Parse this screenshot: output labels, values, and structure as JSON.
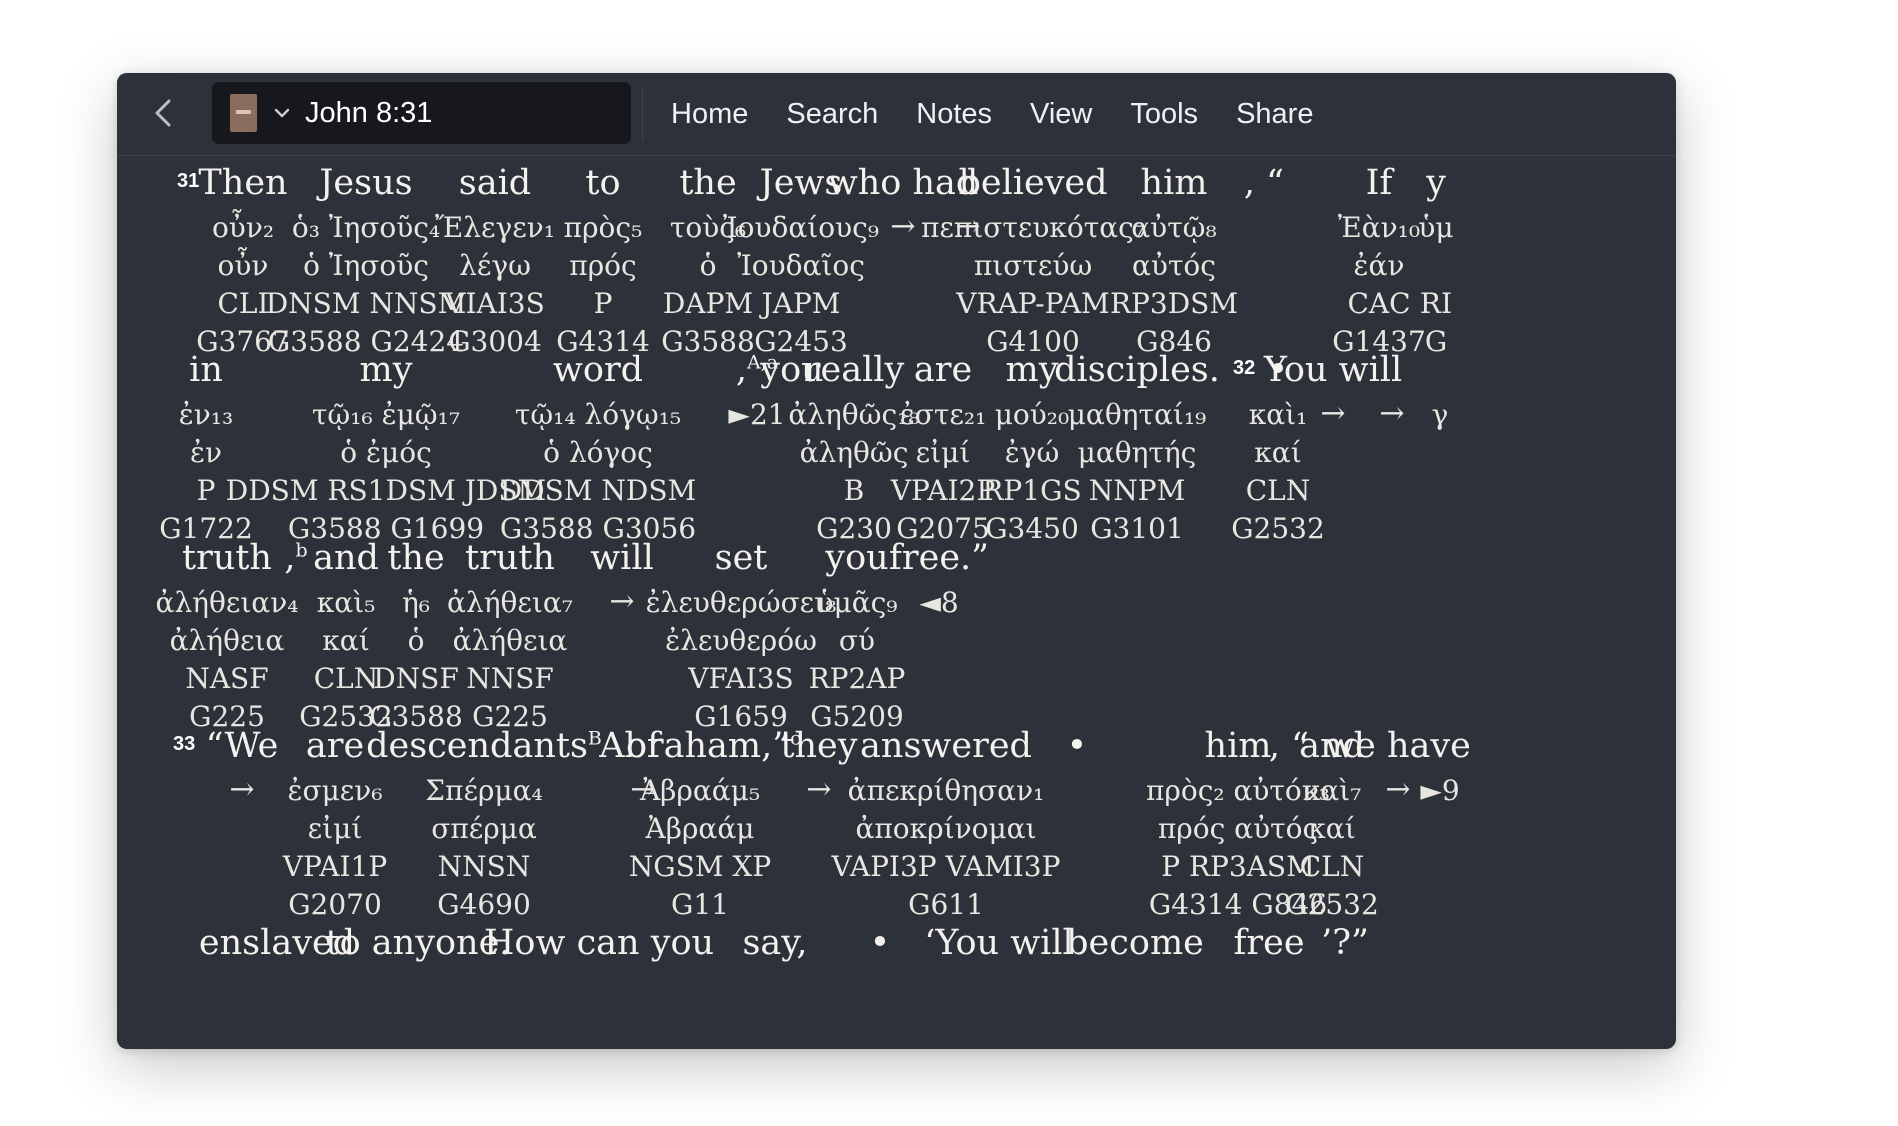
{
  "toolbar": {
    "reference": "John 8:31",
    "menu": [
      "Home",
      "Search",
      "Notes",
      "View",
      "Tools",
      "Share"
    ]
  },
  "icons": {
    "back": "chevron-left-icon",
    "book": "book-cover-icon",
    "dropdown": "chevron-down-icon"
  },
  "interlinear": [
    {
      "verse": "31",
      "words": [
        {
          "en": "Then",
          "gk": "οὖν₂",
          "lem": "οὖν",
          "morph": "CLI",
          "strong": "G3767"
        },
        {
          "en": "Jesus",
          "gk": "ὁ₃ Ἰησοῦς₄",
          "lem": "ὁ Ἰησοῦς",
          "morph": "DNSM NNSM",
          "strong": "G3588 G2424"
        },
        {
          "en": "said",
          "gk": "Ἔλεγεν₁",
          "lem": "λέγω",
          "morph": "VIAI3S",
          "strong": "G3004"
        },
        {
          "en": "to",
          "gk": "πρὸς₅",
          "lem": "πρός",
          "morph": "P",
          "strong": "G4314"
        },
        {
          "en": "the",
          "gk": "τοὺς₆",
          "lem": "ὁ",
          "morph": "DAPM",
          "strong": "G3588"
        },
        {
          "en": "Jews",
          "gk": "Ἰουδαίους₉",
          "lem": "Ἰουδαῖος",
          "morph": "JAPM",
          "strong": "G2453"
        },
        {
          "en": "who had",
          "gk": "→",
          "lem": "",
          "morph": "",
          "strong": ""
        },
        {
          "en": "",
          "gk": "→",
          "lem": "",
          "morph": "",
          "strong": ""
        },
        {
          "en": "believed",
          "gk": "πεπιστευκότας₇",
          "lem": "πιστεύω",
          "morph": "VRAP-PAM",
          "strong": "G4100"
        },
        {
          "en": "him",
          "gk": "αὐτῷ₈",
          "lem": "αὐτός",
          "morph": "RP3DSM",
          "strong": "G846"
        },
        {
          "en": ", “",
          "gk": "",
          "lem": "",
          "morph": "",
          "strong": ""
        },
        {
          "en": "If",
          "gk": "Ἐὰν₁₀",
          "lem": "ἐάν",
          "morph": "CAC",
          "strong": "G1437"
        },
        {
          "en": "y",
          "gk": "ὑμ",
          "lem": "",
          "morph": "RI",
          "strong": "G"
        }
      ]
    },
    {
      "verse": "",
      "words": [
        {
          "en": "in",
          "gk": "ἐν₁₃",
          "lem": "ἐν",
          "morph": "P",
          "strong": "G1722"
        },
        {
          "en": "my",
          "gk": "τῷ₁₆ ἐμῷ₁₇",
          "lem": "ὁ ἐμός",
          "morph": "DDSM RS1DSM JDSM",
          "strong": "G3588 G1699"
        },
        {
          "en": "word",
          "gk": "τῷ₁₄ λόγῳ₁₅",
          "lem": "ὁ λόγος",
          "morph": "DDSM NDSM",
          "strong": "G3588 G3056"
        },
        {
          "en": ",",
          "note": "A,a",
          "gk": "►21",
          "lem": "",
          "morph": "",
          "strong": ""
        },
        {
          "en": "you",
          "gk": "",
          "lem": "",
          "morph": "",
          "strong": ""
        },
        {
          "en": "really",
          "gk": "ἀληθῶς₁₈",
          "lem": "ἀληθῶς",
          "morph": "B",
          "strong": "G230"
        },
        {
          "en": "are",
          "gk": "ἐστε₂₁",
          "lem": "εἰμί",
          "morph": "VPAI2P",
          "strong": "G2075"
        },
        {
          "en": "my",
          "gk": "μού₂₀",
          "lem": "ἐγώ",
          "morph": "RP1GS",
          "strong": "G3450"
        },
        {
          "en": "disciples.",
          "gk": "μαθηταί₁₉",
          "lem": "μαθητής",
          "morph": "NNPM",
          "strong": "G3101"
        },
        {
          "en": "32",
          "gk": "",
          "lem": "",
          "morph": "",
          "strong": ""
        },
        {
          "en": "•",
          "gk": "καὶ₁",
          "lem": "καί",
          "morph": "CLN",
          "strong": "G2532"
        },
        {
          "en": "You will",
          "gk": "→",
          "lem": "",
          "morph": "",
          "strong": ""
        },
        {
          "en": "",
          "gk": "→",
          "lem": "",
          "morph": "",
          "strong": ""
        },
        {
          "en": "",
          "gk": "γ",
          "lem": "",
          "morph": "",
          "strong": ""
        }
      ]
    },
    {
      "verse": "",
      "words": [
        {
          "en": "truth",
          "gk": "ἀλήθειαν₄",
          "lem": "ἀλήθεια",
          "morph": "NASF",
          "strong": "G225"
        },
        {
          "en": ",",
          "note": "b",
          "gk": "",
          "lem": "",
          "morph": "",
          "strong": ""
        },
        {
          "en": "and",
          "gk": "καὶ₅",
          "lem": "καί",
          "morph": "CLN",
          "strong": "G2532"
        },
        {
          "en": "the",
          "gk": "ἡ₆",
          "lem": "ὁ",
          "morph": "DNSF",
          "strong": "G3588"
        },
        {
          "en": "truth",
          "gk": "ἀλήθεια₇",
          "lem": "ἀλήθεια",
          "morph": "NNSF",
          "strong": "G225"
        },
        {
          "en": "will",
          "gk": "→",
          "lem": "",
          "morph": "",
          "strong": ""
        },
        {
          "en": "set",
          "gk": "ἐλευθερώσει₈",
          "lem": "ἐλευθερόω",
          "morph": "VFAI3S",
          "strong": "G1659"
        },
        {
          "en": "you",
          "gk": "ὑμᾶς₉",
          "lem": "σύ",
          "morph": "RP2AP",
          "strong": "G5209"
        },
        {
          "en": "free.”",
          "gk": "◄8",
          "lem": "",
          "morph": "",
          "strong": ""
        }
      ]
    },
    {
      "verse": "33",
      "words": [
        {
          "en": "“We",
          "gk": "→",
          "lem": "",
          "morph": "",
          "strong": ""
        },
        {
          "en": "are",
          "gk": "ἐσμεν₆",
          "lem": "εἰμί",
          "morph": "VPAI1P",
          "strong": "G2070"
        },
        {
          "en": "descendants",
          "note": "B",
          "gk": "Σπέρμα₄",
          "lem": "σπέρμα",
          "morph": "NNSN",
          "strong": "G4690"
        },
        {
          "en": "of",
          "gk": "→",
          "lem": "",
          "morph": "",
          "strong": ""
        },
        {
          "en": "Abraham,”",
          "note": "c",
          "gk": "Ἀβραάμ₅",
          "lem": "Ἀβραάμ",
          "morph": "NGSM XP",
          "strong": "G11"
        },
        {
          "en": "they",
          "gk": "→",
          "lem": "",
          "morph": "",
          "strong": ""
        },
        {
          "en": "answered",
          "gk": "ἀπεκρίθησαν₁",
          "lem": "ἀποκρίνομαι",
          "morph": "VAPI3P VAMI3P",
          "strong": "G611"
        },
        {
          "en": "•",
          "gk": "",
          "lem": "",
          "morph": "",
          "strong": ""
        },
        {
          "en": "him",
          "gk": "πρὸς₂ αὐτόν₃",
          "lem": "πρός αὐτός",
          "morph": "P RP3ASM",
          "strong": "G4314 G846"
        },
        {
          "en": ", “",
          "gk": "",
          "lem": "",
          "morph": "",
          "strong": ""
        },
        {
          "en": "and",
          "gk": "καὶ₇",
          "lem": "καί",
          "morph": "CLN",
          "strong": "G2532"
        },
        {
          "en": "we have",
          "gk": "→",
          "lem": "",
          "morph": "",
          "strong": ""
        },
        {
          "en": "",
          "gk": "►9",
          "lem": "",
          "morph": "",
          "strong": ""
        }
      ]
    },
    {
      "verse": "",
      "words": [
        {
          "en": "enslaved",
          "gk": "",
          "lem": "",
          "morph": "",
          "strong": ""
        },
        {
          "en": "to anyone.",
          "gk": "",
          "lem": "",
          "morph": "",
          "strong": ""
        },
        {
          "en": "How can you",
          "gk": "",
          "lem": "",
          "morph": "",
          "strong": ""
        },
        {
          "en": "say,",
          "gk": "",
          "lem": "",
          "morph": "",
          "strong": ""
        },
        {
          "en": "•",
          "gk": "",
          "lem": "",
          "morph": "",
          "strong": ""
        },
        {
          "en": "‘You will",
          "gk": "",
          "lem": "",
          "morph": "",
          "strong": ""
        },
        {
          "en": "become",
          "gk": "",
          "lem": "",
          "morph": "",
          "strong": ""
        },
        {
          "en": "free",
          "gk": "",
          "lem": "",
          "morph": "",
          "strong": ""
        },
        {
          "en": "’?”",
          "gk": "",
          "lem": "",
          "morph": "",
          "strong": ""
        }
      ]
    }
  ]
}
